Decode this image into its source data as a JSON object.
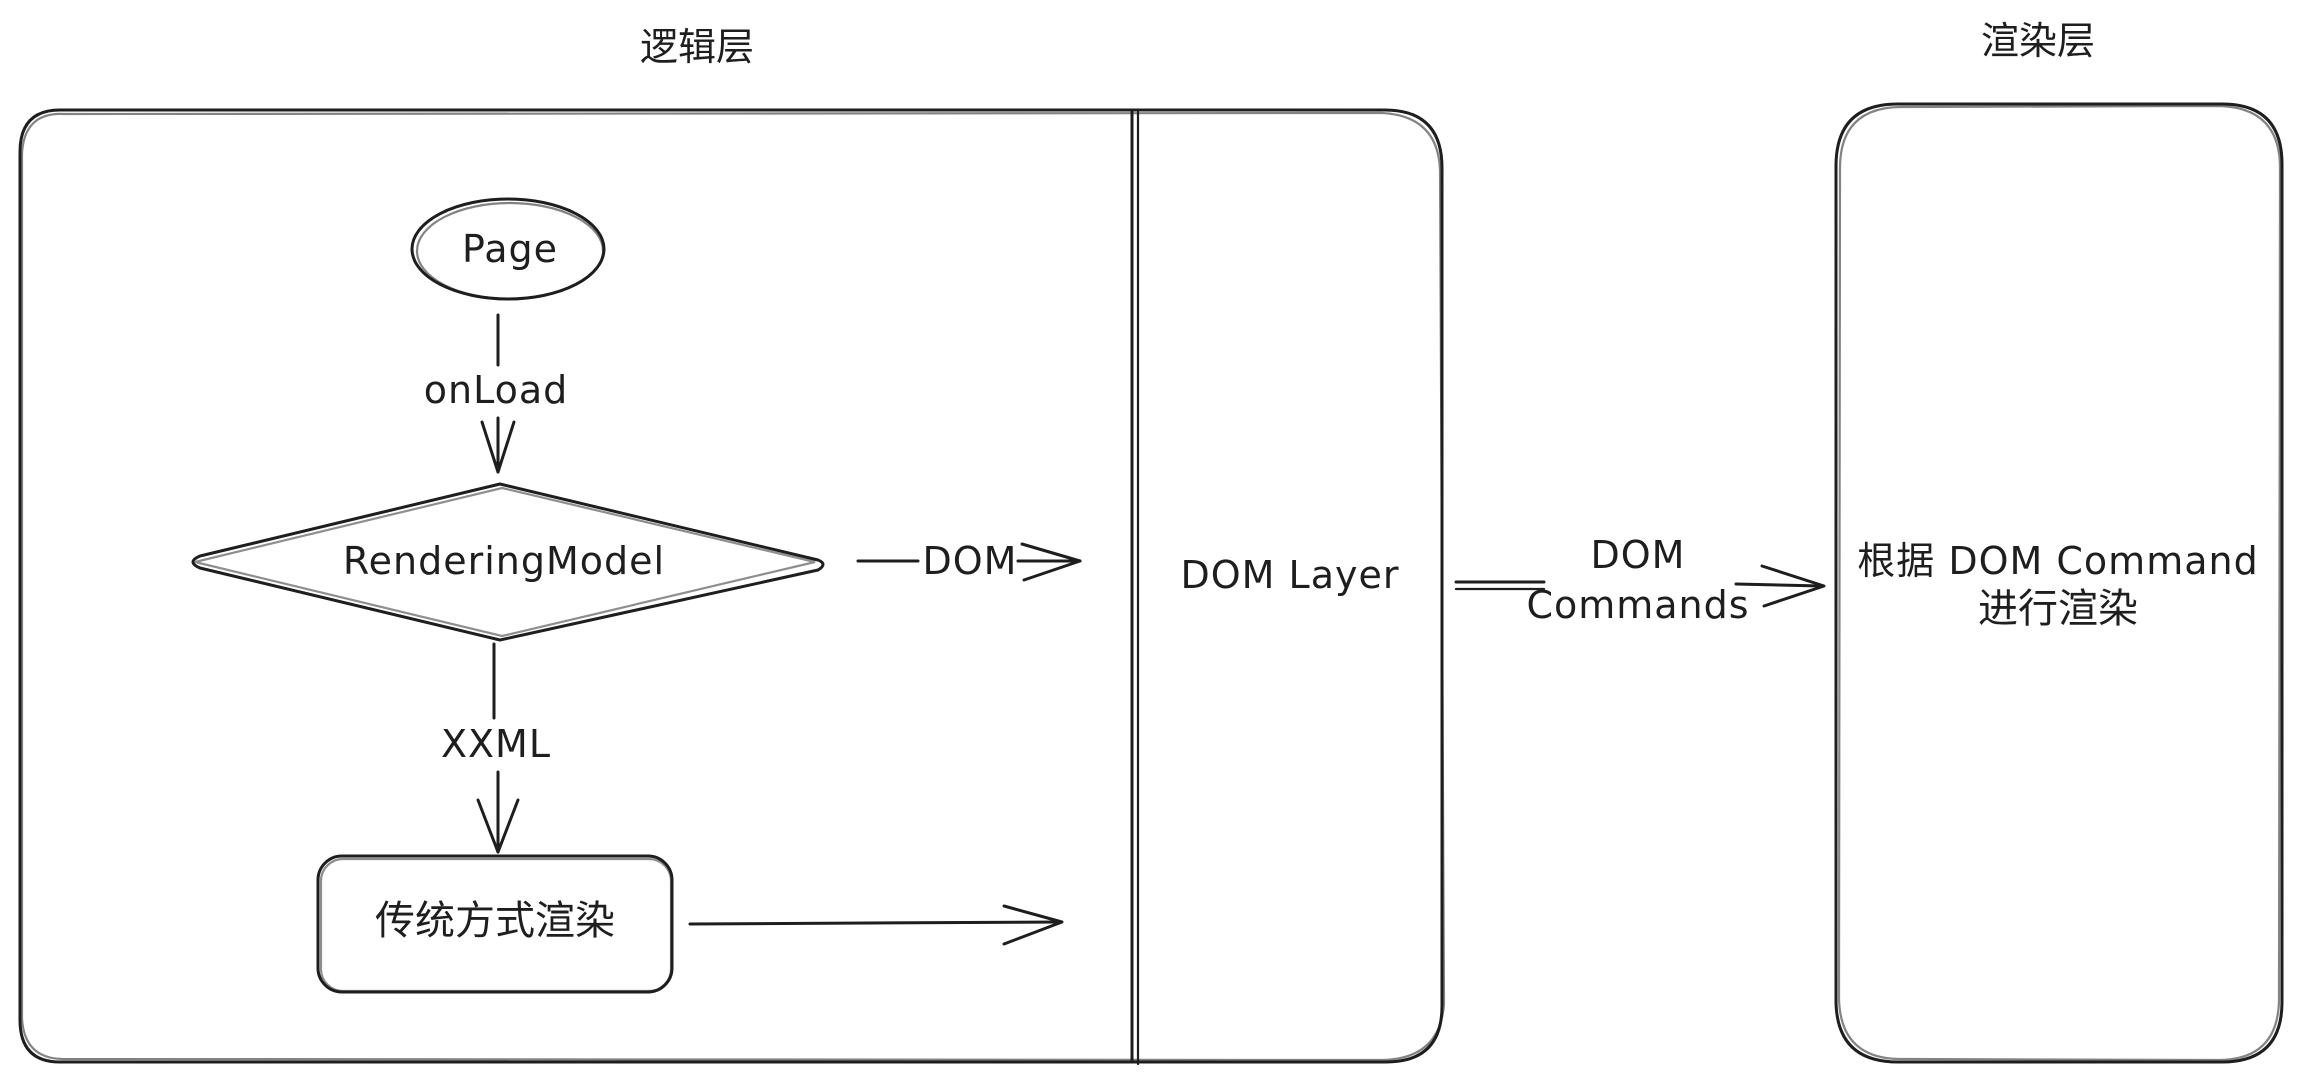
{
  "labels": {
    "logic_layer": "逻辑层",
    "render_layer": "渲染层",
    "page": "Page",
    "on_load": "onLoad",
    "rendering_model": "RenderingModel",
    "dom": "DOM",
    "xxml": "XXML",
    "traditional_render": "传统方式渲染",
    "dom_layer": "DOM Layer",
    "dom_commands_line1": "DOM",
    "dom_commands_line2": "Commands",
    "render_by_line1": "根据 DOM Command",
    "render_by_line2": "进行渲染"
  },
  "colors": {
    "stroke": "#1e1e1e",
    "background": "#ffffff"
  }
}
